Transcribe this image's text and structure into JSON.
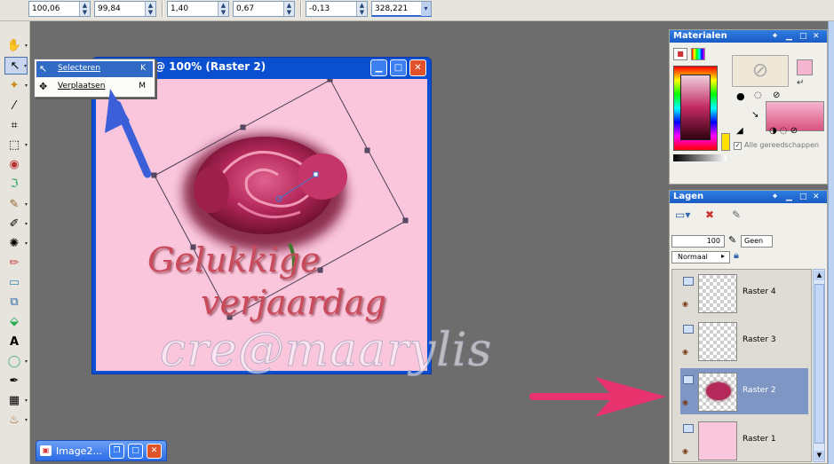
{
  "options": {
    "fields": [
      "100,06",
      "99,84",
      "1,40",
      "0,67",
      "-0,13",
      "328,221"
    ]
  },
  "flyout": {
    "items": [
      {
        "label": "Selecteren",
        "key": "K"
      },
      {
        "label": "Verplaatsen",
        "key": "M"
      }
    ]
  },
  "image_window": {
    "title": "@ 100% (Raster 2)",
    "canvas_text": [
      "Gelukkige",
      "verjaardag"
    ],
    "watermark": "cre@maarylis"
  },
  "minimized": {
    "title": "Image2..."
  },
  "materials": {
    "title": "Materialen",
    "all_tools_label": "Alle gereedschappen"
  },
  "layers": {
    "title": "Lagen",
    "opacity": "100",
    "mask_label": "Geen",
    "blend_mode": "Normaal",
    "rows": [
      {
        "name": "Raster 4"
      },
      {
        "name": "Raster 3"
      },
      {
        "name": "Raster 2"
      },
      {
        "name": "Raster 1"
      }
    ]
  },
  "colors": {
    "titlebar": "#0a4fd0",
    "canvas_bg": "#f9c6dc",
    "selected_layer": "#7e96c4",
    "arrow_blue": "#3a5fd8",
    "arrow_pink": "#e8336f",
    "rose": "#b4285a"
  }
}
